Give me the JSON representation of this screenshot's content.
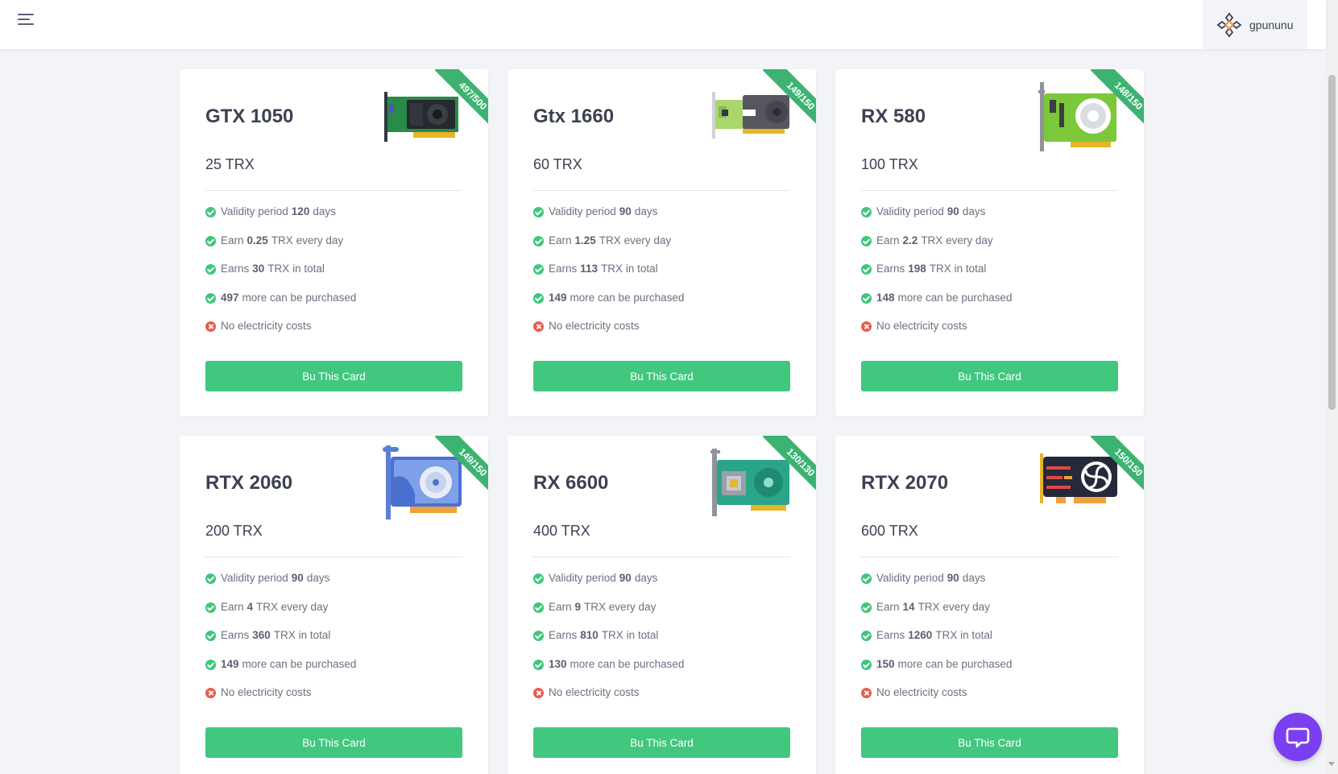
{
  "header": {
    "username": "gpununu",
    "menu_icon": "hamburger-menu-icon",
    "logo_icon": "diamond-logo-icon"
  },
  "colors": {
    "accent_green": "#41c77e",
    "ribbon_green": "#3cb371",
    "error_red": "#ea5b4f",
    "chat_purple": "#7b3ff2"
  },
  "cards": [
    {
      "name": "GTX 1050",
      "price": "25 TRX",
      "stock": "497/500",
      "validity_prefix": "Validity period",
      "validity": "120",
      "validity_suffix": "days",
      "earn_prefix": "Earn",
      "earn": "0.25",
      "earn_suffix": "TRX every day",
      "total_prefix": "Earns",
      "total": "30",
      "total_suffix": "TRX in total",
      "remaining": "497",
      "remaining_suffix": "more can be purchased",
      "electricity": "No electricity costs",
      "button": "Bu This Card",
      "image_icon": "gpu-card-icon"
    },
    {
      "name": "Gtx 1660",
      "price": "60 TRX",
      "stock": "149/150",
      "validity_prefix": "Validity period",
      "validity": "90",
      "validity_suffix": "days",
      "earn_prefix": "Earn",
      "earn": "1.25",
      "earn_suffix": "TRX every day",
      "total_prefix": "Earns",
      "total": "113",
      "total_suffix": "TRX in total",
      "remaining": "149",
      "remaining_suffix": "more can be purchased",
      "electricity": "No electricity costs",
      "button": "Bu This Card",
      "image_icon": "gpu-card-icon"
    },
    {
      "name": "RX 580",
      "price": "100 TRX",
      "stock": "148/150",
      "validity_prefix": "Validity period",
      "validity": "90",
      "validity_suffix": "days",
      "earn_prefix": "Earn",
      "earn": "2.2",
      "earn_suffix": "TRX every day",
      "total_prefix": "Earns",
      "total": "198",
      "total_suffix": "TRX in total",
      "remaining": "148",
      "remaining_suffix": "more can be purchased",
      "electricity": "No electricity costs",
      "button": "Bu This Card",
      "image_icon": "gpu-card-icon"
    },
    {
      "name": "RTX 2060",
      "price": "200 TRX",
      "stock": "149/150",
      "validity_prefix": "Validity period",
      "validity": "90",
      "validity_suffix": "days",
      "earn_prefix": "Earn",
      "earn": "4",
      "earn_suffix": "TRX every day",
      "total_prefix": "Earns",
      "total": "360",
      "total_suffix": "TRX in total",
      "remaining": "149",
      "remaining_suffix": "more can be purchased",
      "electricity": "No electricity costs",
      "button": "Bu This Card",
      "image_icon": "gpu-card-icon"
    },
    {
      "name": "RX 6600",
      "price": "400 TRX",
      "stock": "130/130",
      "validity_prefix": "Validity period",
      "validity": "90",
      "validity_suffix": "days",
      "earn_prefix": "Earn",
      "earn": "9",
      "earn_suffix": "TRX every day",
      "total_prefix": "Earns",
      "total": "810",
      "total_suffix": "TRX in total",
      "remaining": "130",
      "remaining_suffix": "more can be purchased",
      "electricity": "No electricity costs",
      "button": "Bu This Card",
      "image_icon": "gpu-card-icon"
    },
    {
      "name": "RTX 2070",
      "price": "600 TRX",
      "stock": "150/150",
      "validity_prefix": "Validity period",
      "validity": "90",
      "validity_suffix": "days",
      "earn_prefix": "Earn",
      "earn": "14",
      "earn_suffix": "TRX every day",
      "total_prefix": "Earns",
      "total": "1260",
      "total_suffix": "TRX in total",
      "remaining": "150",
      "remaining_suffix": "more can be purchased",
      "electricity": "No electricity costs",
      "button": "Bu This Card",
      "image_icon": "gpu-card-icon"
    }
  ],
  "chat": {
    "icon": "chat-bubble-icon"
  }
}
